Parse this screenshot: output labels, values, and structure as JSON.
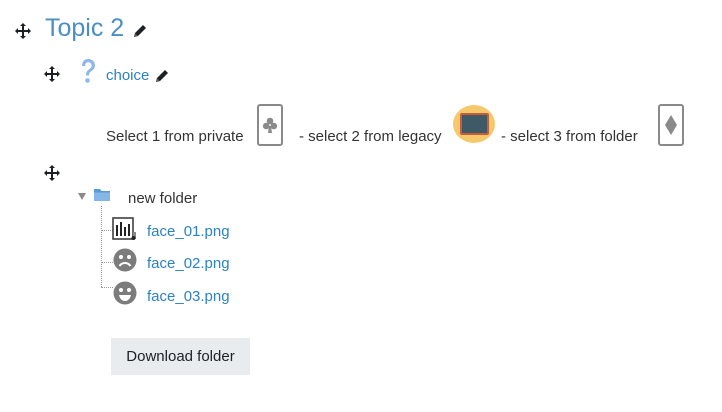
{
  "section": {
    "title": "Topic 2"
  },
  "activity": {
    "name": "choice",
    "icon": "question-mark-icon"
  },
  "description": {
    "part1": "Select 1 from private",
    "part2": "- select 2 from legacy",
    "part3": "- select 3 from folder",
    "images": [
      "club-card-icon",
      "monitor-icon",
      "diamond-card-icon"
    ]
  },
  "folder": {
    "name": "new folder",
    "icon": "folder-icon",
    "files": [
      {
        "name": "face_01.png",
        "icon": "image-file-icon"
      },
      {
        "name": "face_02.png",
        "icon": "sad-face-icon"
      },
      {
        "name": "face_03.png",
        "icon": "smile-face-icon"
      }
    ],
    "download_label": "Download folder"
  },
  "colors": {
    "link": "#2b82c4",
    "title": "#4a8fc4",
    "button_bg": "#e9ecef",
    "legacy_bg": "#f6c86c"
  }
}
